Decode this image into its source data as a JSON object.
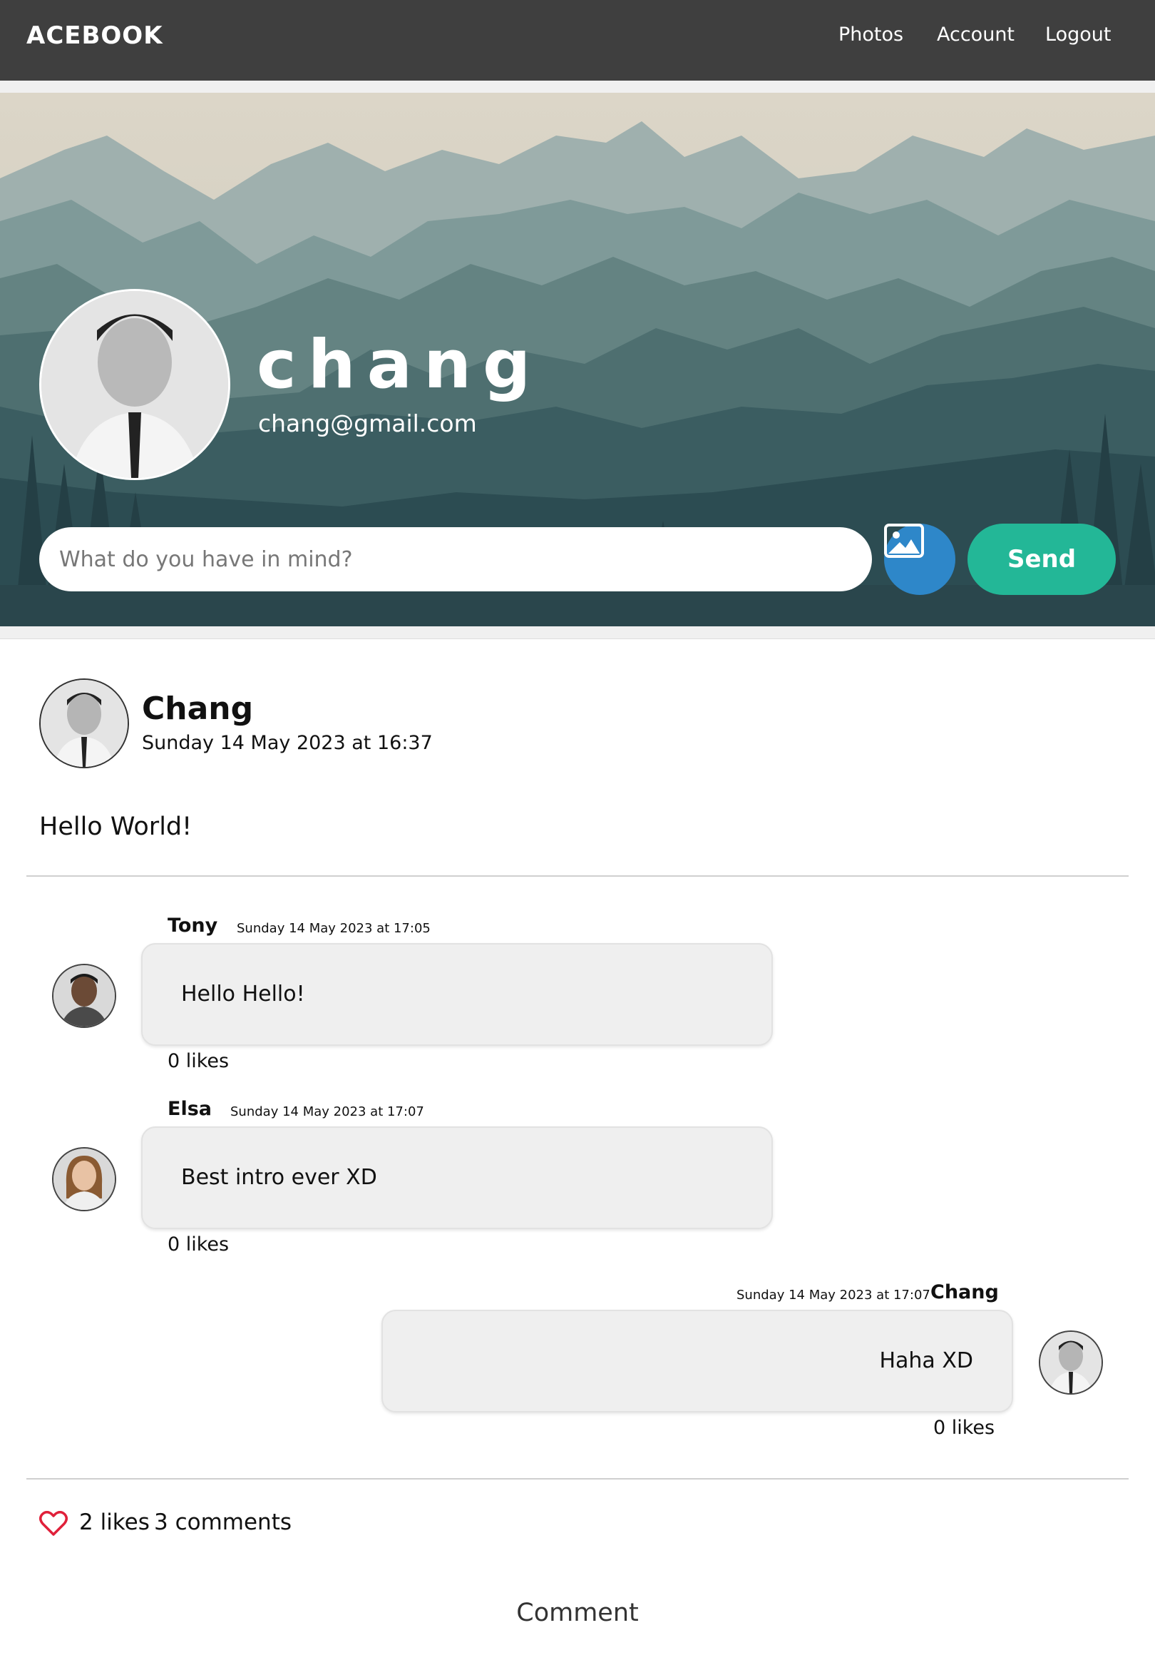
{
  "navbar": {
    "brand": "ACEBOOK",
    "links": [
      "Photos",
      "Account",
      "Logout"
    ]
  },
  "profile": {
    "name": "chang",
    "email": "chang@gmail.com"
  },
  "composer": {
    "placeholder": "What do you have in mind?",
    "send_label": "Send",
    "image_icon": "image-icon"
  },
  "post": {
    "author": "Chang",
    "date": "Sunday 14 May 2023 at 16:37",
    "text": "Hello World!",
    "comments": [
      {
        "name": "Tony",
        "date": "Sunday 14 May 2023 at 17:05",
        "text": "Hello Hello!",
        "likes": "0 likes"
      },
      {
        "name": "Elsa",
        "date": "Sunday 14 May 2023 at 17:07",
        "text": "Best intro ever XD",
        "likes": "0 likes"
      },
      {
        "name": "Chang",
        "date": "Sunday 14 May 2023 at 17:07",
        "text": "Haha XD",
        "likes": "0 likes"
      }
    ],
    "likes_count": "2 likes",
    "comments_count": "3 comments",
    "comment_button": "Comment"
  },
  "colors": {
    "navbar": "#3f3f3f",
    "send_button": "#23b797",
    "image_button": "#2e87c9",
    "heart": "#e0203a"
  }
}
